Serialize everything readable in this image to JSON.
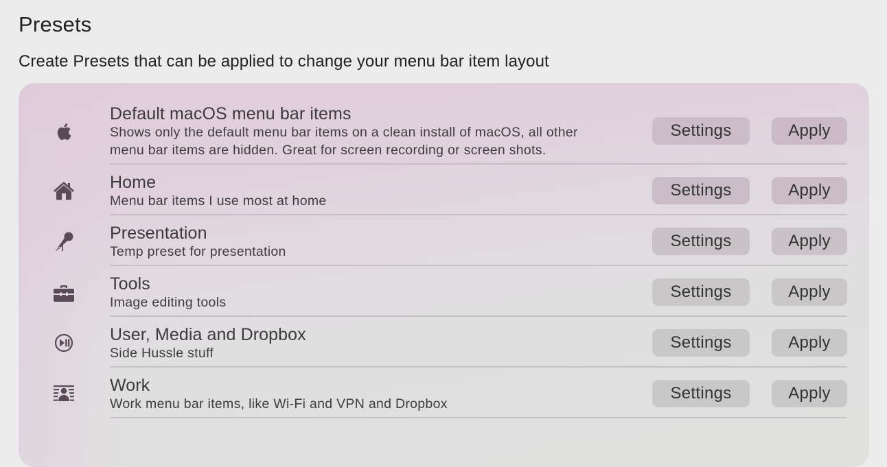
{
  "header": {
    "title": "Presets",
    "subtitle": "Create Presets that can be applied to change your menu bar item layout"
  },
  "presets": [
    {
      "icon": "apple-logo-icon",
      "title": "Default macOS menu bar items",
      "description_lines": [
        "Shows only the default menu bar items on a clean install of macOS, all other",
        "menu bar items are hidden. Great for screen recording or screen shots."
      ],
      "settings_label": "Settings",
      "apply_label": "Apply"
    },
    {
      "icon": "house-icon",
      "title": "Home",
      "description_lines": [
        "Menu bar items I use most at home"
      ],
      "settings_label": "Settings",
      "apply_label": "Apply"
    },
    {
      "icon": "microphone-icon",
      "title": "Presentation",
      "description_lines": [
        "Temp preset for presentation"
      ],
      "settings_label": "Settings",
      "apply_label": "Apply"
    },
    {
      "icon": "toolbox-icon",
      "title": "Tools",
      "description_lines": [
        "Image editing tools"
      ],
      "settings_label": "Settings",
      "apply_label": "Apply"
    },
    {
      "icon": "play-pause-circle-icon",
      "title": "User, Media and Dropbox",
      "description_lines": [
        "Side Hussle stuff"
      ],
      "settings_label": "Settings",
      "apply_label": "Apply"
    },
    {
      "icon": "person-text-wrap-icon",
      "title": "Work",
      "description_lines": [
        "Work menu bar items, like Wi-Fi and VPN and Dropbox"
      ],
      "settings_label": "Settings",
      "apply_label": "Apply"
    }
  ],
  "colors": {
    "icon": "#5a4a58",
    "button_tinted": "#cbbcc7",
    "button_neutral": "#c8c8c8"
  }
}
